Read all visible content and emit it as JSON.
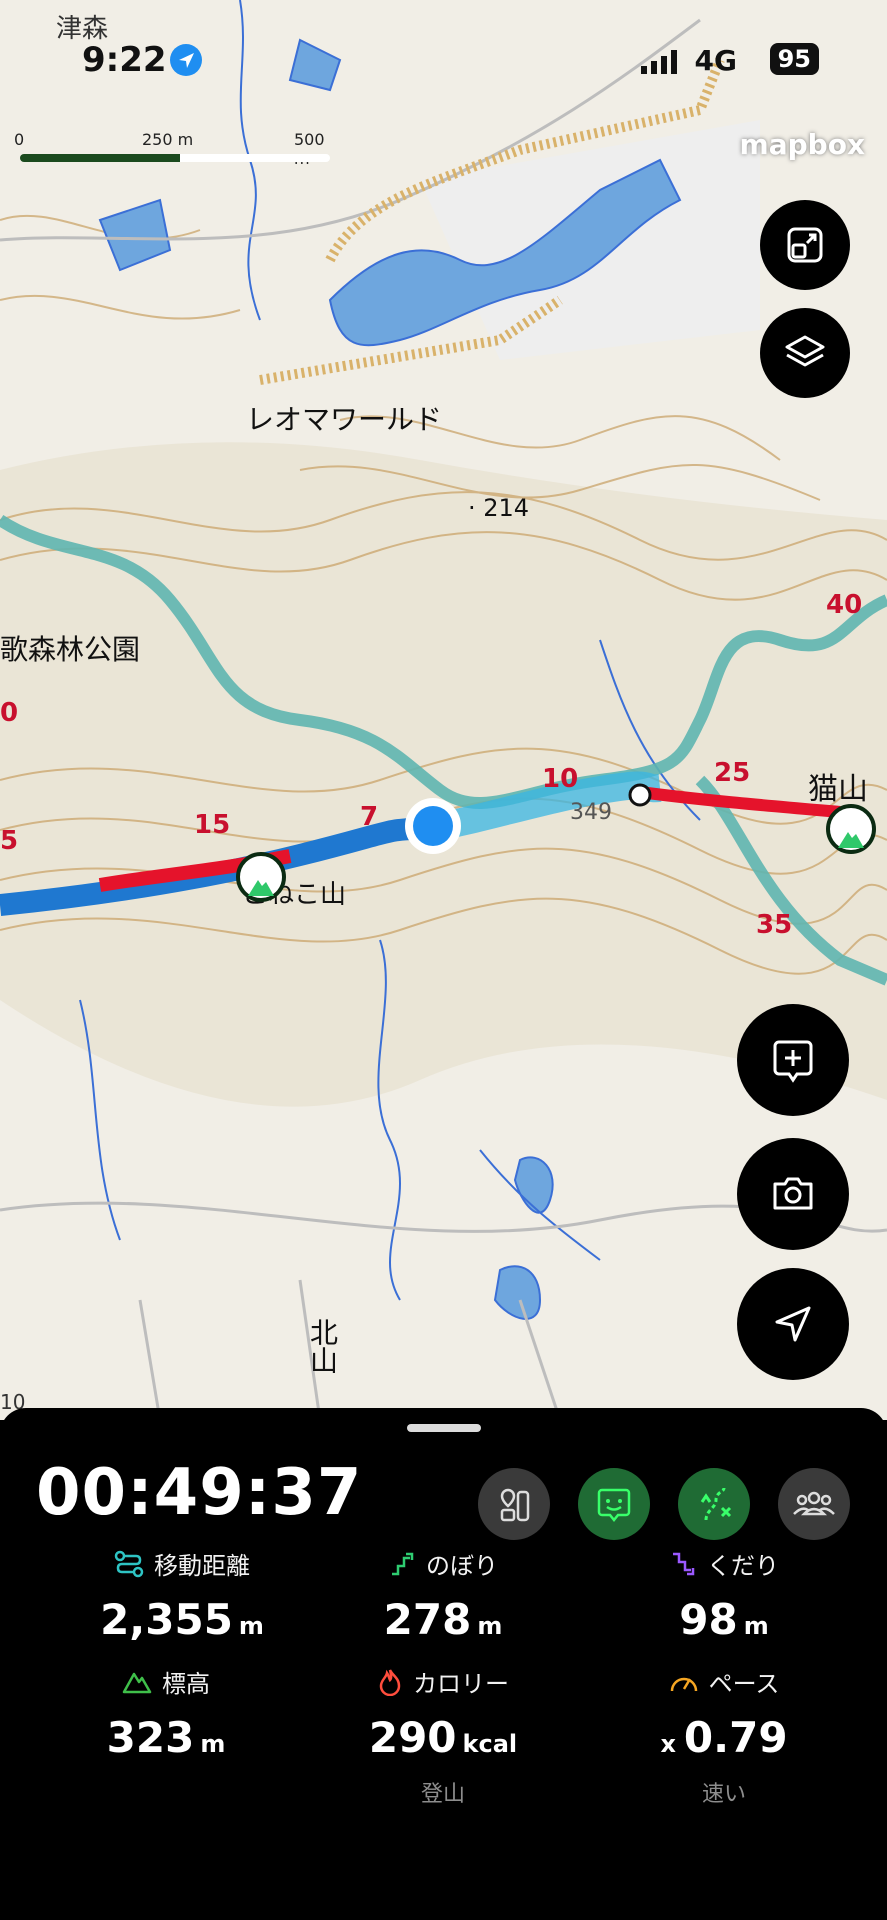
{
  "status_bar": {
    "time": "9:22",
    "network": "4G",
    "battery": "95"
  },
  "map": {
    "scale": {
      "labels": [
        "0",
        "250 m",
        "500 m"
      ]
    },
    "attribution": "mapbox",
    "labels": {
      "top_left": "津森",
      "theme_park": "レオマワールド",
      "elevation_point": "214",
      "park": "歌森林公園",
      "kone_yama": "こねこ山",
      "neko_yama": "猫山",
      "kita_yama": "北山",
      "point_349": "349",
      "bottom_left_num": "10"
    },
    "route_numbers": [
      "15",
      "7",
      "10",
      "25",
      "40",
      "35",
      "15",
      "5",
      "0"
    ],
    "buttons": {
      "expand": "expand-icon",
      "layers": "layers-icon",
      "add": "add-post-icon",
      "camera": "camera-icon",
      "locate": "navigation-arrow-icon"
    }
  },
  "panel": {
    "timer": "00:49:37",
    "buttons": [
      {
        "name": "route-map-icon",
        "active": false
      },
      {
        "name": "face-plus-icon",
        "active": true
      },
      {
        "name": "route-switch-icon",
        "active": true
      },
      {
        "name": "group-icon",
        "active": false
      }
    ],
    "stats": {
      "distance": {
        "label": "移動距離",
        "value": "2,355",
        "unit": "m",
        "icon_color": "#2ec4c4"
      },
      "ascent": {
        "label": "のぼり",
        "value": "278",
        "unit": "m",
        "icon_color": "#2ecc71"
      },
      "descent": {
        "label": "くだり",
        "value": "98",
        "unit": "m",
        "icon_color": "#9b59ff"
      },
      "altitude": {
        "label": "標高",
        "value": "323",
        "unit": "m",
        "icon_color": "#3fbf4a"
      },
      "calories": {
        "label": "カロリー",
        "value": "290",
        "unit": "kcal",
        "sub": "登山",
        "icon_color": "#ff4d3d"
      },
      "pace": {
        "label": "ペース",
        "prefix": "x",
        "value": "0.79",
        "sub": "速い",
        "icon_color": "#f5a623"
      }
    }
  },
  "colors": {
    "accent_green": "#2fc86a",
    "route_blue": "#39b6e3",
    "route_red": "#e5132b"
  }
}
